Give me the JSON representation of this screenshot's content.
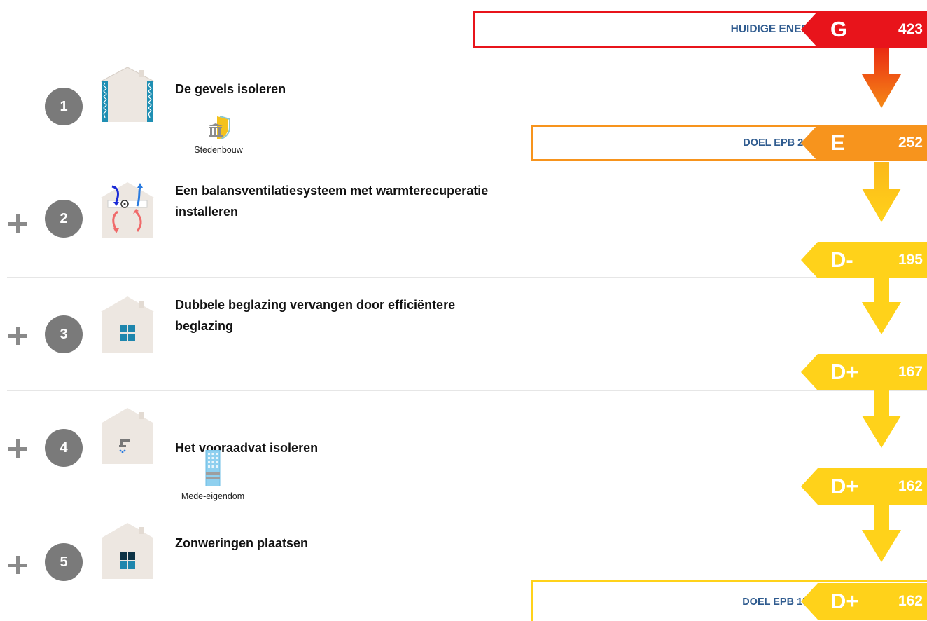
{
  "current": {
    "label": "HUIDIGE ENERGIEPRESTATIE",
    "class": "G",
    "value": "423",
    "color": "#e8141b"
  },
  "steps": [
    {
      "number": "1",
      "title": "De gevels isoleren",
      "badge": "Stedenbouw",
      "badge_icon": "building-shield-icon",
      "result": {
        "class": "E",
        "value": "252",
        "color": "#f7941d",
        "label": "DOEL EPB 275 BEREIKT",
        "label_icon": "check-icon"
      }
    },
    {
      "number": "2",
      "title_lines": [
        "Een balansventilatiesysteem met warmterecuperatie",
        "installeren"
      ],
      "result": {
        "class": "D-",
        "value": "195",
        "color": "#ffd21a"
      }
    },
    {
      "number": "3",
      "title_lines": [
        "Dubbele beglazing vervangen door efficiëntere",
        "beglazing"
      ],
      "result": {
        "class": "D+",
        "value": "167",
        "color": "#ffd21a"
      }
    },
    {
      "number": "4",
      "title": "Het vooraadvat isoleren",
      "badge": "Mede-eigendom",
      "badge_icon": "apartment-building-icon",
      "result": {
        "class": "D+",
        "value": "162",
        "color": "#ffd21a"
      }
    },
    {
      "number": "5",
      "title": "Zonweringen plaatsen",
      "result": {
        "class": "D+",
        "value": "162",
        "color": "#ffd21a",
        "label": "DOEL EPB 150 NIET BEREIKT"
      }
    }
  ],
  "colors": {
    "label_text": "#2f5b8f",
    "step_circle": "#7a7a7a",
    "house_wall": "#ede7e1",
    "check": "#2e9e36"
  }
}
